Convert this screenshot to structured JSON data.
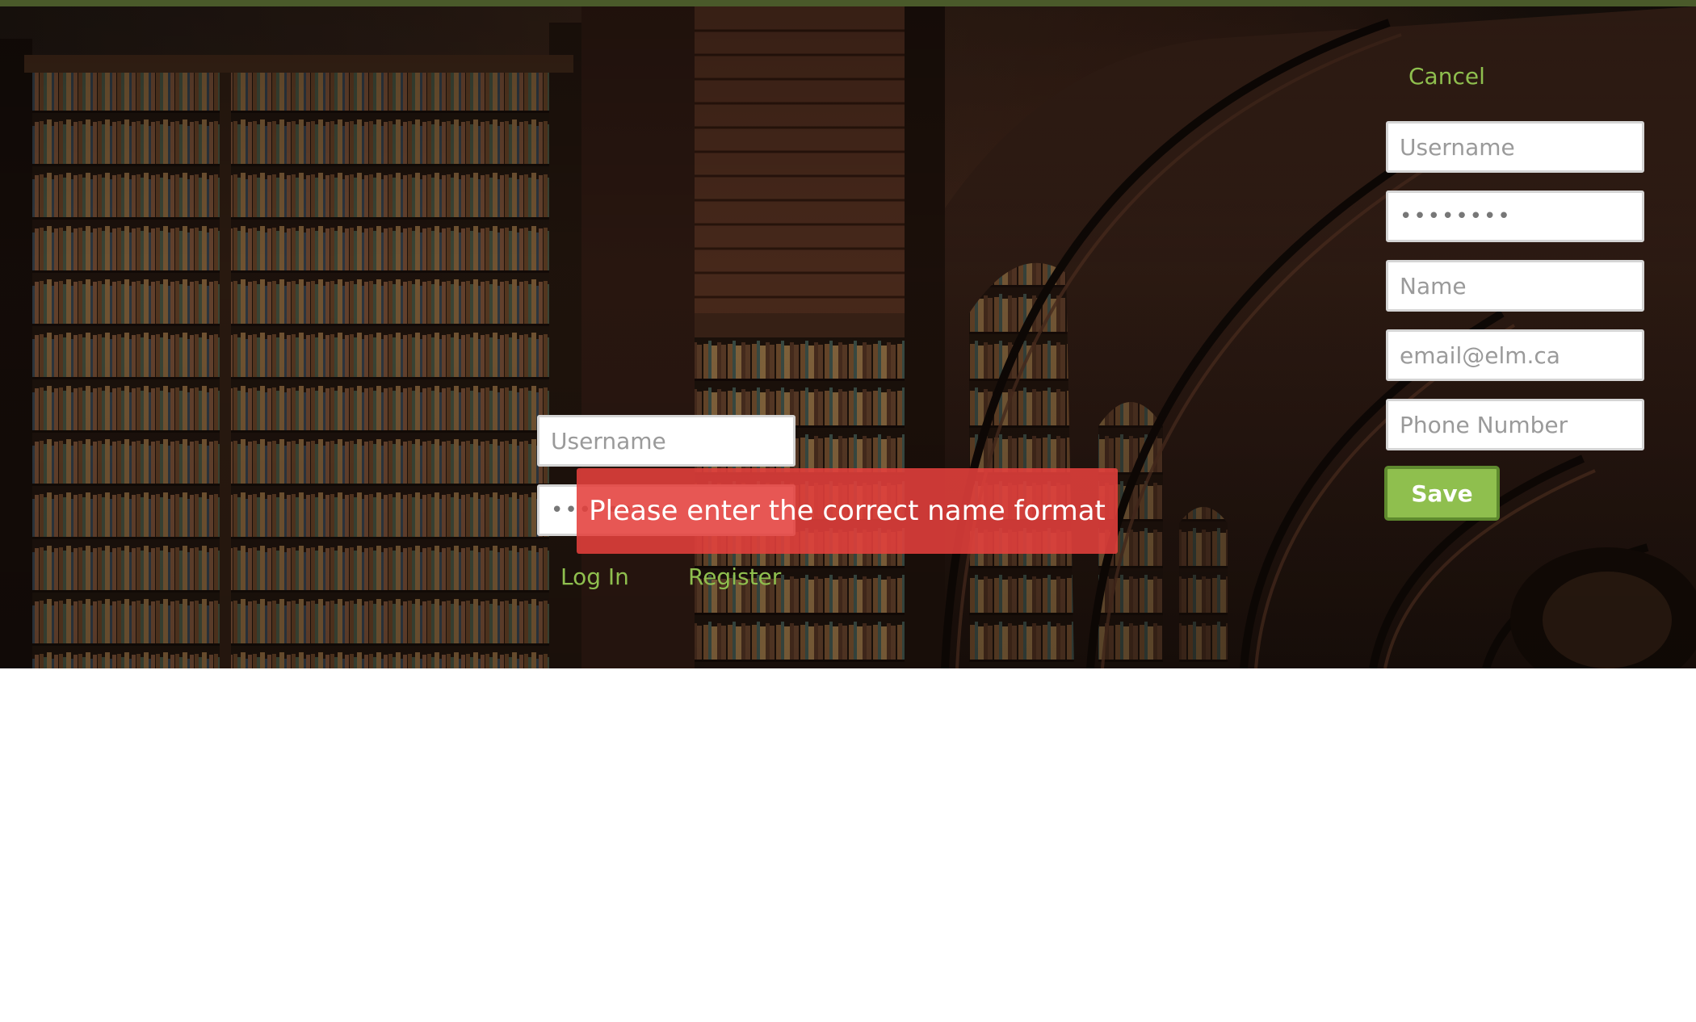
{
  "login": {
    "username_placeholder": "Username",
    "password_value": "••••••••",
    "login_label": "Log In",
    "register_label": "Register"
  },
  "register": {
    "cancel_label": "Cancel",
    "username_placeholder": "Username",
    "password_value": "••••••••",
    "name_placeholder": "Name",
    "email_placeholder": "email@elm.ca",
    "phone_placeholder": "Phone Number",
    "save_label": "Save"
  },
  "error_toast": {
    "message": "Please enter the correct name format"
  },
  "colors": {
    "accent_green": "#8fbf4e",
    "save_border": "#5e8a2e",
    "error_red": "#e4403c"
  }
}
